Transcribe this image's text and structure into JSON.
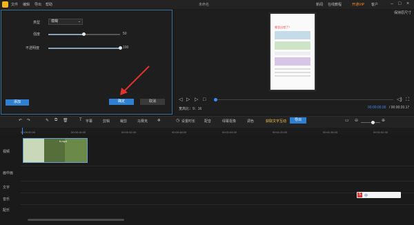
{
  "titlebar": {
    "menu": [
      "文件",
      "编辑",
      "导出",
      "帮助"
    ],
    "title": "未命名",
    "right_items": [
      "新闻",
      "在线教程",
      "开通VIP",
      "客户"
    ]
  },
  "panel": {
    "type_label": "类型",
    "type_value": "模糊",
    "strength_label": "强度",
    "strength_value": "50",
    "strength_level": 0.5,
    "opacity_label": "不透明度",
    "opacity_value": "100",
    "opacity_level": 1.0,
    "add_label": "添加",
    "ok_label": "确定",
    "cancel_label": "取消"
  },
  "preview": {
    "orig_ratio": "保持原尺寸",
    "ratio_label": "宽高比：9：16",
    "current_time": "00:00:00.00",
    "total_time": "/ 00:00:20.17",
    "phone_title": "哪里出错了？"
  },
  "toolbar": {
    "tools": [
      "字幕",
      "剪辑",
      "裁剪",
      "马赛克",
      "设置时长",
      "配音",
      "绿幕抠像",
      "调色"
    ],
    "promo": "获取文字互动",
    "export_label": "导出"
  },
  "ruler": {
    "ticks": [
      "00:00:00.00",
      "00:00:16.00",
      "00:00:32.00",
      "00:00:48.00",
      "00:01:04.00",
      "00:01:20.00",
      "00:01:36.00",
      "00:01:52.00"
    ]
  },
  "tracks": [
    "视频",
    "画中画",
    "文字",
    "音乐",
    "配乐"
  ],
  "clip": {
    "label": "6.mp4"
  },
  "ime": {
    "text": "中"
  },
  "icons": [
    "undo-icon",
    "redo-icon",
    "pen-icon",
    "delete-icon",
    "text-icon",
    "play-icon",
    "volume-icon",
    "zoom-in-icon",
    "zoom-out-icon",
    "fullscreen-icon"
  ],
  "colors": {
    "accent": "#2f80d0",
    "highlight": "#3b8cff",
    "promo": "#f2c44b"
  }
}
